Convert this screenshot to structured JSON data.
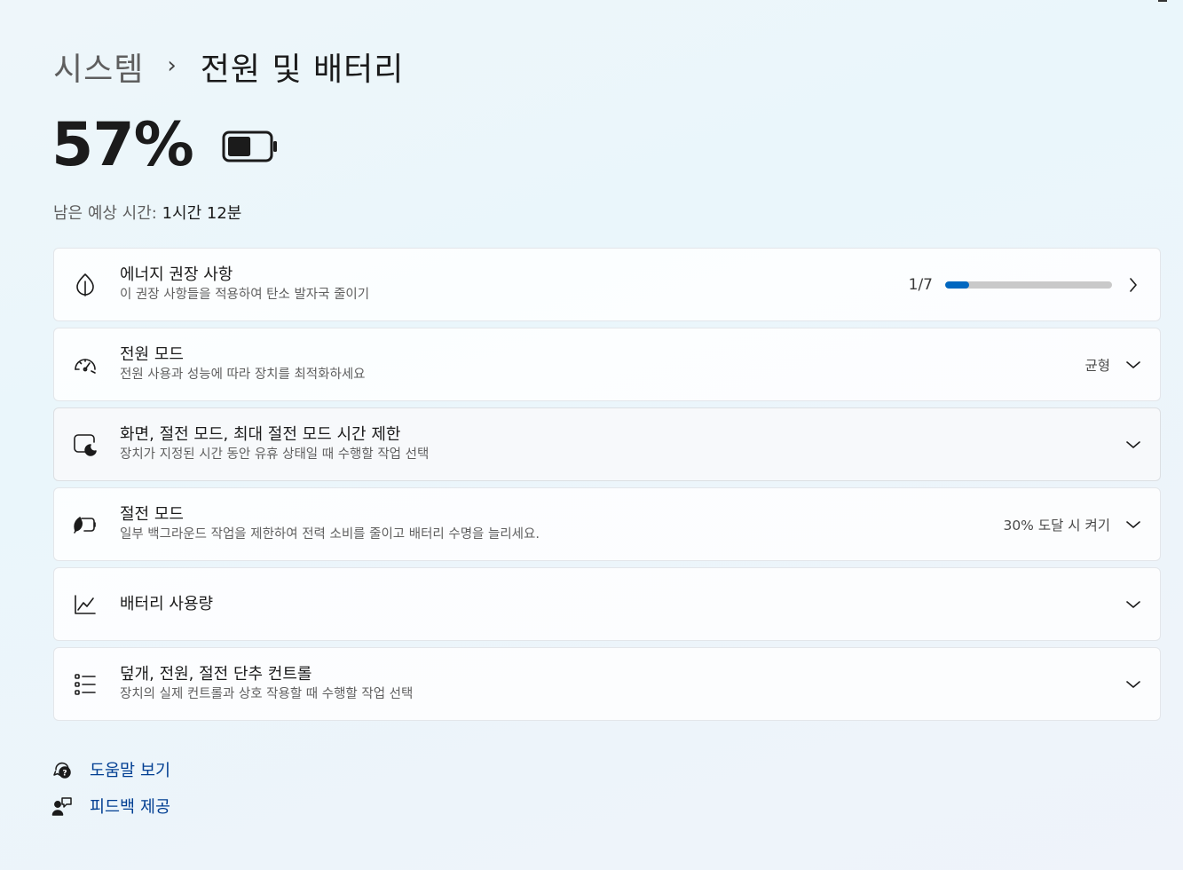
{
  "breadcrumb": {
    "parent": "시스템",
    "separator": "›",
    "current": "전원 및 배터리"
  },
  "battery": {
    "percent_text": "57%",
    "level": 0.57,
    "remaining_label": "남은 예상 시간:",
    "remaining_value": "1시간 12분"
  },
  "cards": {
    "energy": {
      "icon": "leaf-icon",
      "title": "에너지 권장 사항",
      "subtitle": "이 권장 사항들을 적용하여 탄소 발자국 줄이기",
      "progress_label": "1/7",
      "progress": 0.143
    },
    "power_mode": {
      "icon": "speedometer-icon",
      "title": "전원 모드",
      "subtitle": "전원 사용과 성능에 따라 장치를 최적화하세요",
      "value": "균형"
    },
    "screen_sleep": {
      "icon": "screen-sleep-icon",
      "title": "화면, 절전 모드, 최대 절전 모드 시간 제한",
      "subtitle": "장치가 지정된 시간 동안 유휴 상태일 때 수행할 작업 선택"
    },
    "battery_saver": {
      "icon": "battery-saver-icon",
      "title": "절전 모드",
      "subtitle": "일부 백그라운드 작업을 제한하여 전력 소비를 줄이고 배터리 수명을 늘리세요.",
      "value": "30% 도달 시 켜기"
    },
    "battery_usage": {
      "icon": "line-chart-icon",
      "title": "배터리 사용량"
    },
    "lid_power": {
      "icon": "list-icon",
      "title": "덮개, 전원, 절전 단추 컨트롤",
      "subtitle": "장치의 실제 컨트롤과 상호 작용할 때 수행할 작업 선택"
    }
  },
  "links": {
    "help": "도움말 보기",
    "feedback": "피드백 제공"
  },
  "colors": {
    "accent": "#0067c0",
    "link": "#003e92"
  }
}
